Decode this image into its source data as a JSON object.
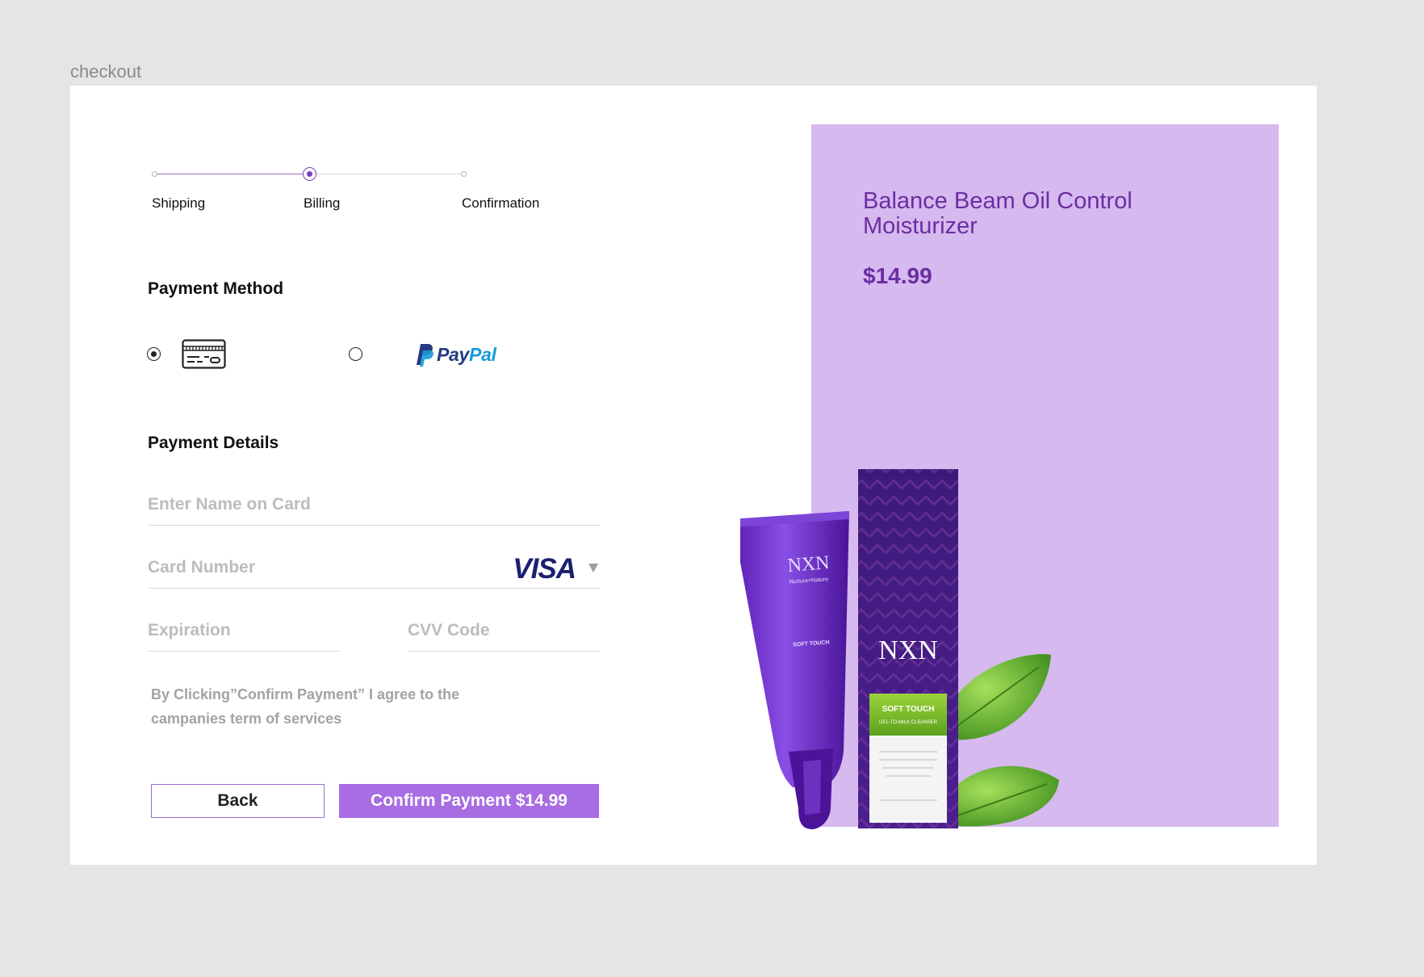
{
  "frame": {
    "label": "checkout"
  },
  "stepper": {
    "steps": [
      {
        "label": "Shipping",
        "state": "done"
      },
      {
        "label": "Billing",
        "state": "current"
      },
      {
        "label": "Confirmation",
        "state": "todo"
      }
    ]
  },
  "payment_method": {
    "title": "Payment Method",
    "options": [
      {
        "id": "card",
        "icon": "credit-card-icon",
        "selected": true
      },
      {
        "id": "paypal",
        "brand_pay": "Pay",
        "brand_pal": "Pal",
        "selected": false
      }
    ]
  },
  "payment_details": {
    "title": "Payment Details",
    "name_placeholder": "Enter Name on Card",
    "card_placeholder": "Card Number",
    "card_brand": "VISA",
    "expiration_placeholder": "Expiration",
    "cvv_placeholder": "CVV Code"
  },
  "terms": "By Clicking”Confirm Payment” I agree to the campanies term of services",
  "buttons": {
    "back": "Back",
    "confirm": "Confirm Payment $14.99"
  },
  "product": {
    "name": "Balance Beam Oil Control Moisturizer",
    "price": "$14.99",
    "image_brand": "NXN",
    "image_tagline": "Nurture×Nature",
    "image_product_title": "SOFT TOUCH",
    "image_product_subtitle": "GEL-TO-MILK CLEANSER"
  },
  "colors": {
    "accent": "#a86ce3",
    "accent_dark": "#6b2ea1",
    "panel": "#d5b9ef",
    "visa": "#1a1f71",
    "paypal_dark": "#253b80",
    "paypal_light": "#179bd7"
  }
}
